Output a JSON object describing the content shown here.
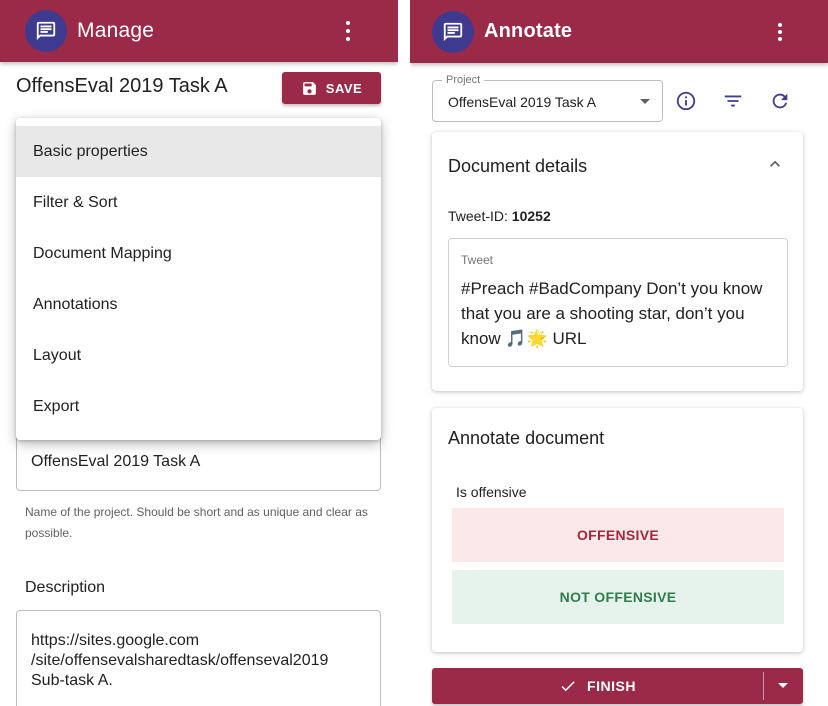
{
  "manage": {
    "title": "Manage",
    "project_title": "OffensEval 2019 Task A",
    "save_label": "SAVE",
    "menu_items": [
      {
        "label": "Basic properties",
        "active": true
      },
      {
        "label": "Filter & Sort"
      },
      {
        "label": "Document Mapping"
      },
      {
        "label": "Annotations"
      },
      {
        "label": "Layout"
      },
      {
        "label": "Export"
      }
    ],
    "name_value": "OffensEval 2019 Task A",
    "name_helper": "Name of the project. Should be short and as unique and clear as possible.",
    "description_label": "Description",
    "description_lines": [
      "https://sites.google.com",
      "/site/offensevalsharedtask/offenseval2019",
      "Sub-task A."
    ]
  },
  "annotate": {
    "title": "Annotate",
    "project_legend": "Project",
    "project_value": "OffensEval 2019 Task A",
    "details_title": "Document details",
    "tweet_id_label": "Tweet-ID:",
    "tweet_id_value": "10252",
    "tweet_legend": "Tweet",
    "tweet_text": "#Preach #BadCompany Don’t you know that you are a shooting star, don’t you know 🎵🌟 URL",
    "annotate_title": "Annotate document",
    "question": "Is offensive",
    "option_offensive": "OFFENSIVE",
    "option_not_offensive": "NOT OFFENSIVE",
    "finish_label": "FINISH"
  },
  "colors": {
    "primary": "#9b2a48",
    "avatar": "#3e3a8f",
    "offensive_bg": "#fbe9e9",
    "not_offensive_bg": "#e6f3ec"
  },
  "icons": [
    "chat-icon",
    "more-vert-icon",
    "save-icon",
    "info-icon",
    "filter-icon",
    "refresh-icon",
    "expand-less-icon",
    "check-icon",
    "arrow-drop-down-icon"
  ]
}
